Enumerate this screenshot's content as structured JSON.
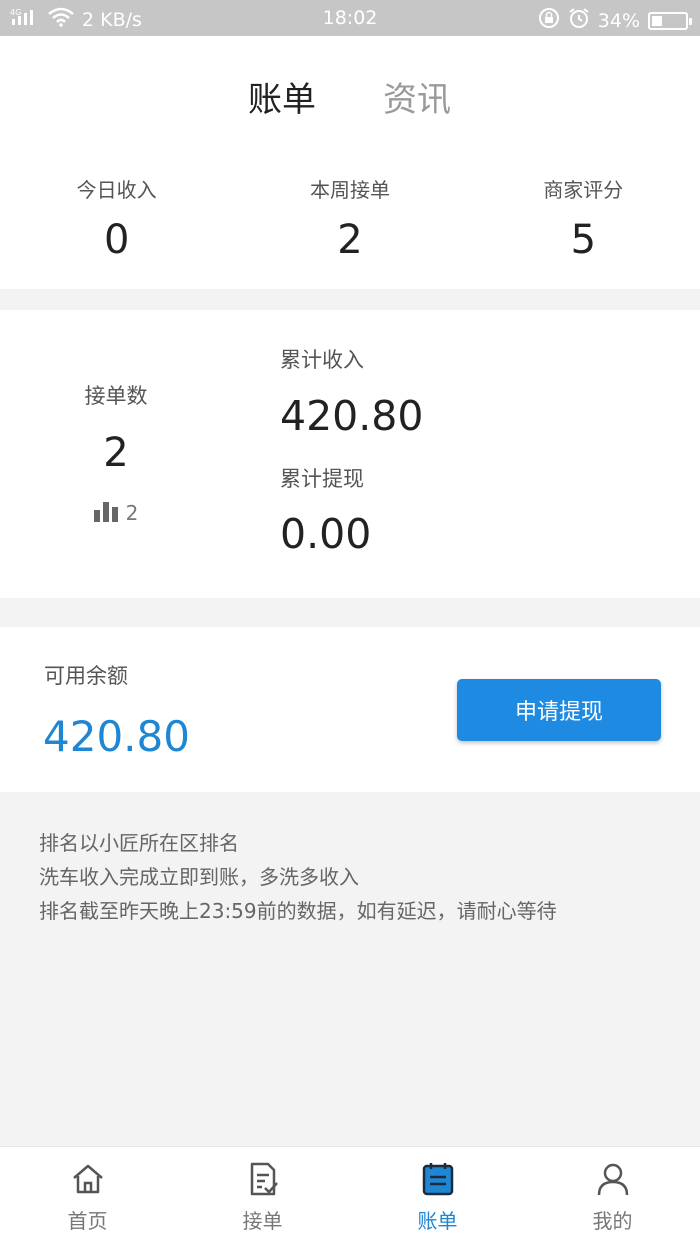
{
  "status_bar": {
    "network": "4G",
    "speed": "2 KB/s",
    "time": "18:02",
    "battery": "34%"
  },
  "header": {
    "tabs": [
      "账单",
      "资讯"
    ],
    "active_tab": "账单"
  },
  "stats": [
    {
      "label": "今日收入",
      "value": "0"
    },
    {
      "label": "本周接单",
      "value": "2"
    },
    {
      "label": "商家评分",
      "value": "5"
    }
  ],
  "summary": {
    "orders_label": "接单数",
    "orders_value": "2",
    "rank_value": "2",
    "total_income_label": "累计收入",
    "total_income_value": "420.80",
    "total_withdraw_label": "累计提现",
    "total_withdraw_value": "0.00"
  },
  "balance": {
    "label": "可用余额",
    "value": "420.80",
    "button_label": "申请提现"
  },
  "notes": [
    "排名以小匠所在区排名",
    "洗车收入完成立即到账，多洗多收入",
    "排名截至昨天晚上23:59前的数据，如有延迟，请耐心等待"
  ],
  "bottom_nav": [
    {
      "label": "首页",
      "icon": "home-icon"
    },
    {
      "label": "接单",
      "icon": "order-list-icon"
    },
    {
      "label": "账单",
      "icon": "bill-icon"
    },
    {
      "label": "我的",
      "icon": "profile-icon"
    }
  ],
  "colors": {
    "accent": "#1e86d3",
    "button": "#1e8ae2"
  }
}
